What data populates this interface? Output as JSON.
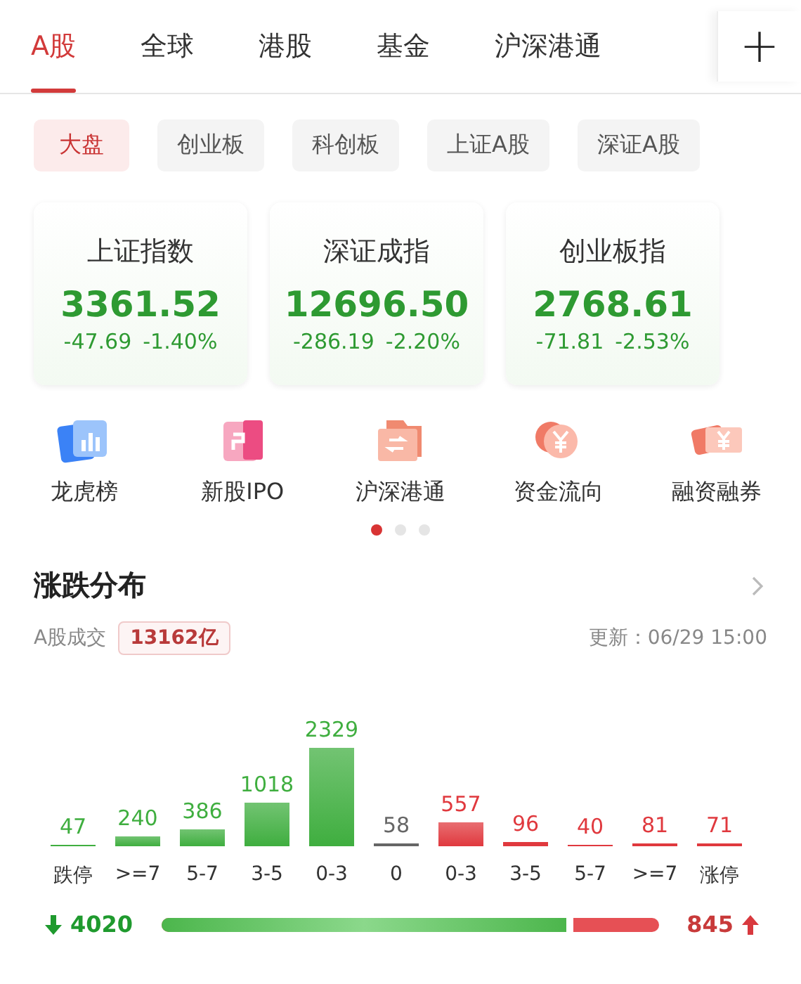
{
  "tabs": [
    {
      "label": "A股",
      "selected": true
    },
    {
      "label": "全球",
      "selected": false
    },
    {
      "label": "港股",
      "selected": false
    },
    {
      "label": "基金",
      "selected": false
    },
    {
      "label": "沪深港通",
      "selected": false
    }
  ],
  "add_button": "+",
  "chips": [
    {
      "label": "大盘",
      "selected": true
    },
    {
      "label": "创业板",
      "selected": false
    },
    {
      "label": "科创板",
      "selected": false
    },
    {
      "label": "上证A股",
      "selected": false
    },
    {
      "label": "深证A股",
      "selected": false
    }
  ],
  "indices": [
    {
      "name": "上证指数",
      "value": "3361.52",
      "change": "-47.69",
      "percent": "-1.40%"
    },
    {
      "name": "深证成指",
      "value": "12696.50",
      "change": "-286.19",
      "percent": "-2.20%"
    },
    {
      "name": "创业板指",
      "value": "2768.61",
      "change": "-71.81",
      "percent": "-2.53%"
    }
  ],
  "shortcuts": [
    {
      "kind": "chart",
      "label": "龙虎榜"
    },
    {
      "kind": "ipo",
      "label": "新股IPO"
    },
    {
      "kind": "exchange",
      "label": "沪深港通"
    },
    {
      "kind": "yuan",
      "label": "资金流向"
    },
    {
      "kind": "ticket",
      "label": "融资融券"
    }
  ],
  "pager": [
    {
      "selected": true
    },
    {
      "selected": false
    },
    {
      "selected": false
    }
  ],
  "distribution": {
    "title": "涨跌分布",
    "volume_label": "A股成交",
    "volume": "13162亿",
    "updated": "更新：06/29 15:00",
    "chart_data": {
      "type": "bar",
      "categories": [
        "跌停",
        ">=7",
        "5-7",
        "3-5",
        "0-3",
        "0",
        "0-3",
        "3-5",
        "5-7",
        ">=7",
        "涨停"
      ],
      "data_labels": true,
      "series": [
        {
          "color": "#3fae3f",
          "values": [
            47,
            240,
            386,
            1018,
            2329,
            null,
            null,
            null,
            null,
            null,
            null
          ]
        },
        {
          "color": "#666666",
          "values": [
            null,
            null,
            null,
            null,
            null,
            58,
            null,
            null,
            null,
            null,
            null
          ]
        },
        {
          "color": "#e0393e",
          "values": [
            null,
            null,
            null,
            null,
            null,
            null,
            557,
            96,
            40,
            81,
            71
          ]
        }
      ]
    },
    "down_count": "4020",
    "up_count": "845",
    "level": 0.83
  }
}
